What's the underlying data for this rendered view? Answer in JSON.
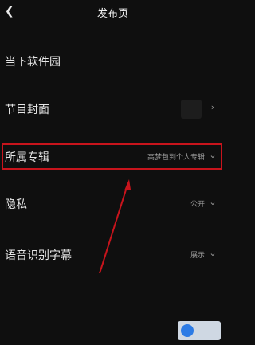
{
  "header": {
    "back_icon": "chevron-left-icon",
    "title": "发布页"
  },
  "rows": {
    "name": {
      "label": "当下软件园"
    },
    "cover": {
      "label": "节目封面",
      "chevron_icon": "chevron-right-icon"
    },
    "album": {
      "label": "所属专辑",
      "value": "高梦包到个人专辑",
      "chevron_icon": "chevron-down-icon"
    },
    "privacy": {
      "label": "隐私",
      "value": "公开",
      "chevron_icon": "chevron-down-icon"
    },
    "subtitle": {
      "label": "语音识别字幕",
      "value": "展示",
      "chevron_icon": "chevron-down-icon"
    }
  },
  "annotation": {
    "highlight_color": "#c8141c",
    "arrow_color": "#c8141c"
  },
  "watermark": {
    "logo_icon": "brand-logo-icon"
  }
}
